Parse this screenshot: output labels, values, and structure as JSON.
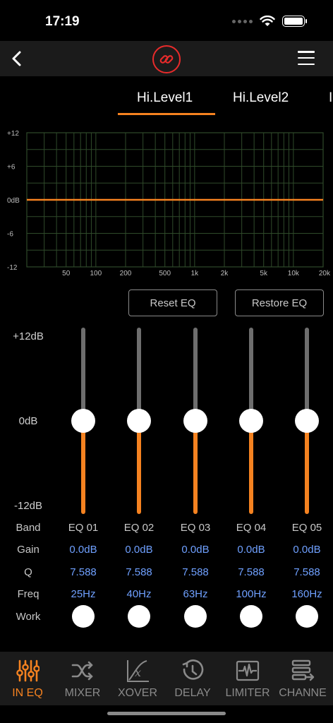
{
  "status": {
    "time": "17:19"
  },
  "nav": {
    "back_icon": "chevron-left-icon",
    "center_icon": "link-icon",
    "menu_icon": "hamburger-menu-icon",
    "accent": "#e82b2b"
  },
  "tabs": [
    {
      "label": "Hi.Level1",
      "active": true
    },
    {
      "label": "Hi.Level2",
      "active": false
    },
    {
      "label": "I",
      "active": false
    }
  ],
  "graph": {
    "y_ticks": [
      "+12",
      "+6",
      "0dB",
      "-6",
      "-12"
    ],
    "x_ticks": [
      "50",
      "100",
      "200",
      "500",
      "1k",
      "2k",
      "5k",
      "10k",
      "20k"
    ],
    "curve_gain_db": 0,
    "line_color": "#f58220",
    "grid_color": "#2f4a2a"
  },
  "buttons": {
    "reset": "Reset EQ",
    "restore": "Restore EQ"
  },
  "db_scale": {
    "top": "+12dB",
    "mid": "0dB",
    "bottom": "-12dB"
  },
  "rows": {
    "band": "Band",
    "gain": "Gain",
    "q": "Q",
    "freq": "Freq",
    "work": "Work"
  },
  "bands": [
    {
      "band": "EQ 01",
      "gain": "0.0dB",
      "q": "7.588",
      "freq": "25Hz",
      "gain_value": 0,
      "work": true
    },
    {
      "band": "EQ 02",
      "gain": "0.0dB",
      "q": "7.588",
      "freq": "40Hz",
      "gain_value": 0,
      "work": true
    },
    {
      "band": "EQ 03",
      "gain": "0.0dB",
      "q": "7.588",
      "freq": "63Hz",
      "gain_value": 0,
      "work": true
    },
    {
      "band": "EQ 04",
      "gain": "0.0dB",
      "q": "7.588",
      "freq": "100Hz",
      "gain_value": 0,
      "work": true
    },
    {
      "band": "EQ 05",
      "gain": "0.0dB",
      "q": "7.588",
      "freq": "160Hz",
      "gain_value": 0,
      "work": true
    }
  ],
  "bottom_nav": [
    {
      "label": "IN EQ",
      "icon": "sliders-icon",
      "active": true
    },
    {
      "label": "MIXER",
      "icon": "shuffle-icon",
      "active": false
    },
    {
      "label": "XOVER",
      "icon": "function-graph-icon",
      "active": false
    },
    {
      "label": "DELAY",
      "icon": "clock-icon",
      "active": false
    },
    {
      "label": "LIMITER",
      "icon": "waveform-icon",
      "active": false
    },
    {
      "label": "CHANNE",
      "icon": "channel-stack-icon",
      "active": false
    }
  ],
  "colors": {
    "accent": "#f58220",
    "value_blue": "#6fa0ff",
    "bar_bg": "#1b1b1b"
  }
}
